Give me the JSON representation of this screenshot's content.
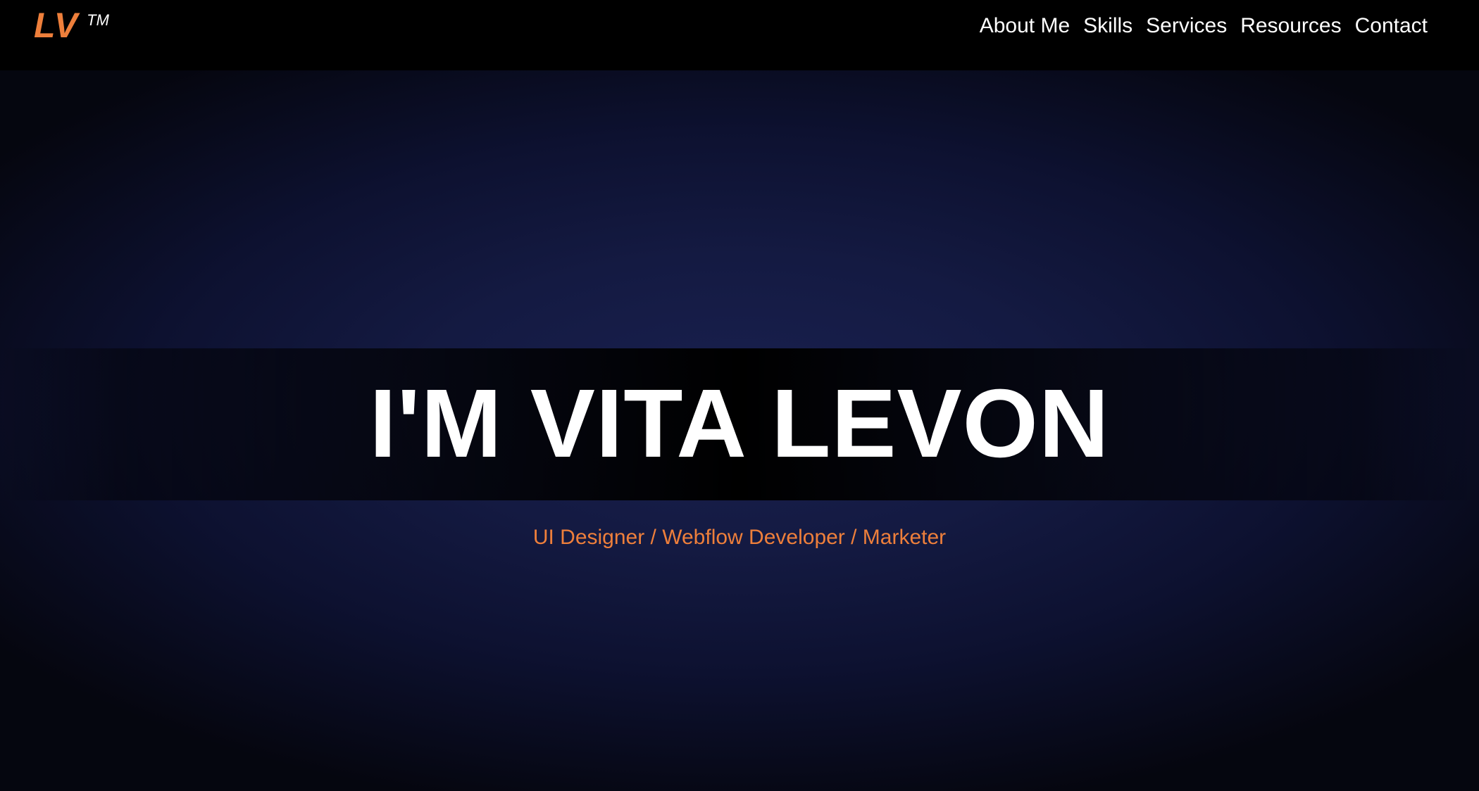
{
  "navbar": {
    "logo": {
      "mark": "LV",
      "trademark": "TM"
    },
    "links": [
      {
        "label": "About Me"
      },
      {
        "label": "Skills"
      },
      {
        "label": "Services"
      },
      {
        "label": "Resources"
      },
      {
        "label": "Contact"
      }
    ]
  },
  "hero": {
    "title": "I'M VITA LEVON",
    "subtitle": "UI Designer / Webflow Developer / Marketer"
  },
  "colors": {
    "accent": "#ee7f3b",
    "navbar_background": "#000000",
    "hero_background_center": "#19204f",
    "hero_background_edge": "#05060f",
    "text": "#ffffff"
  }
}
